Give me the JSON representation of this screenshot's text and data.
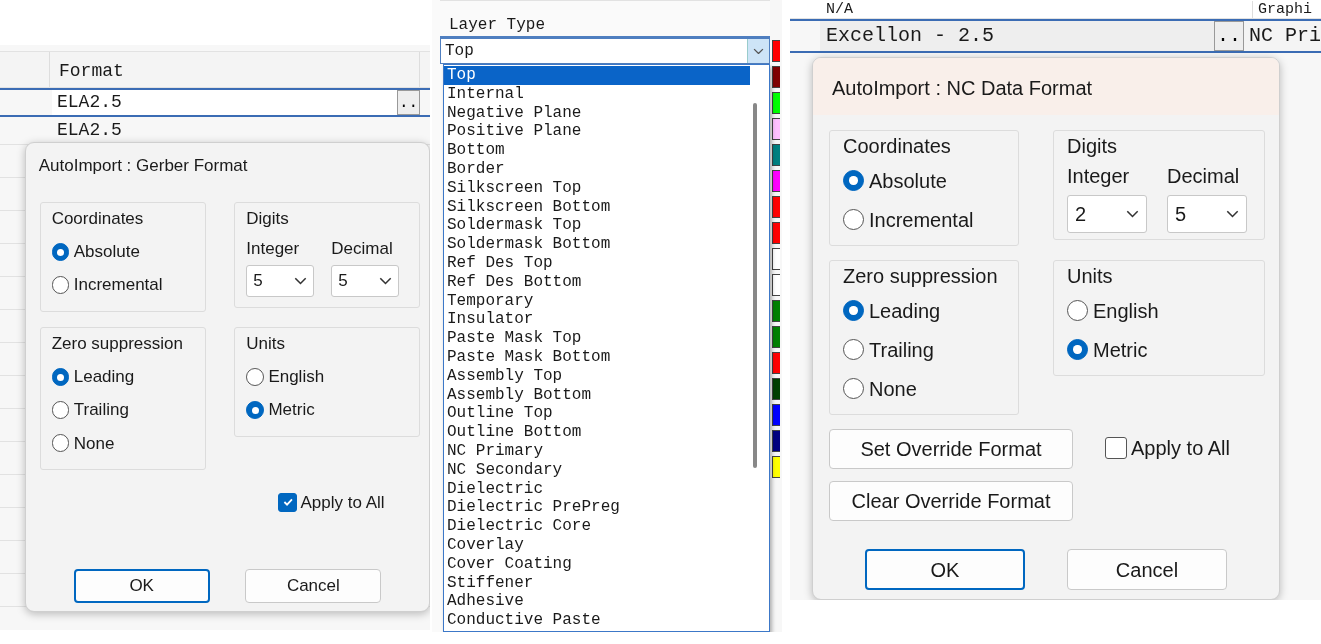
{
  "gerber_panel": {
    "table": {
      "header": "Format",
      "rows": [
        {
          "value": "ELA2.5",
          "selected": true,
          "button": ".."
        },
        {
          "value": "ELA2.5",
          "selected": false
        }
      ]
    },
    "dialog": {
      "kind": "gerber",
      "title": "AutoImport : Gerber Format",
      "groups": [
        {
          "kind": "radio",
          "title": "Coordinates",
          "options": [
            {
              "label": "Absolute",
              "selected": true
            },
            {
              "label": "Incremental",
              "selected": false
            }
          ]
        },
        {
          "kind": "dropdowns",
          "title": "Digits",
          "fields": [
            {
              "label": "Integer",
              "value": "5"
            },
            {
              "label": "Decimal",
              "value": "5"
            }
          ]
        },
        {
          "kind": "radio",
          "title": "Zero suppression",
          "options": [
            {
              "label": "Leading",
              "selected": true
            },
            {
              "label": "Trailing",
              "selected": false
            },
            {
              "label": "None",
              "selected": false
            }
          ]
        },
        {
          "kind": "radio",
          "title": "Units",
          "options": [
            {
              "label": "English",
              "selected": false
            },
            {
              "label": "Metric",
              "selected": true
            }
          ]
        }
      ],
      "apply_to_all": {
        "label": "Apply to All",
        "checked": true
      },
      "buttons": [
        {
          "label": "OK",
          "default": true
        },
        {
          "label": "Cancel",
          "default": false
        }
      ]
    }
  },
  "layer_type_panel": {
    "header": "Layer Type",
    "combo_value": "Top",
    "items": [
      {
        "label": "Top",
        "selected": true
      },
      {
        "label": "Internal",
        "selected": false
      },
      {
        "label": "Negative Plane",
        "selected": false
      },
      {
        "label": "Positive Plane",
        "selected": false
      },
      {
        "label": "Bottom",
        "selected": false
      },
      {
        "label": "Border",
        "selected": false
      },
      {
        "label": "Silkscreen Top",
        "selected": false
      },
      {
        "label": "Silkscreen Bottom",
        "selected": false
      },
      {
        "label": "Soldermask Top",
        "selected": false
      },
      {
        "label": "Soldermask Bottom",
        "selected": false
      },
      {
        "label": "Ref Des Top",
        "selected": false
      },
      {
        "label": "Ref Des Bottom",
        "selected": false
      },
      {
        "label": "Temporary",
        "selected": false
      },
      {
        "label": "Insulator",
        "selected": false
      },
      {
        "label": "Paste Mask Top",
        "selected": false
      },
      {
        "label": "Paste Mask Bottom",
        "selected": false
      },
      {
        "label": "Assembly Top",
        "selected": false
      },
      {
        "label": "Assembly Bottom",
        "selected": false
      },
      {
        "label": "Outline Top",
        "selected": false
      },
      {
        "label": "Outline Bottom",
        "selected": false
      },
      {
        "label": "NC Primary",
        "selected": false
      },
      {
        "label": "NC Secondary",
        "selected": false
      },
      {
        "label": "Dielectric",
        "selected": false
      },
      {
        "label": "Dielectric PrePreg",
        "selected": false
      },
      {
        "label": "Dielectric Core",
        "selected": false
      },
      {
        "label": "Coverlay",
        "selected": false
      },
      {
        "label": "Cover Coating",
        "selected": false
      },
      {
        "label": "Stiffener",
        "selected": false
      },
      {
        "label": "Adhesive",
        "selected": false
      },
      {
        "label": "Conductive Paste",
        "selected": false
      }
    ],
    "layer_colors": [
      {
        "color": "#ff0000"
      },
      {
        "color": "#800000"
      },
      {
        "color": "#00ff00"
      },
      {
        "color": "#ffc0ff"
      },
      {
        "color": "#008080"
      },
      {
        "color": "#ff00ff"
      },
      {
        "color": "#ff0000"
      },
      {
        "color": "#ff0000"
      },
      {
        "color": "#ffffff"
      },
      {
        "color": "#ffffff"
      },
      {
        "color": "#008000"
      },
      {
        "color": "#008000"
      },
      {
        "color": "#ff0000"
      },
      {
        "color": "#004000"
      },
      {
        "color": "#0000ff"
      },
      {
        "color": "#000080"
      },
      {
        "color": "#ffff00"
      }
    ]
  },
  "nc_panel": {
    "top_row": [
      "N/A",
      "Graphi"
    ],
    "row": {
      "value": "Excellon - 2.5",
      "selected": true,
      "button": "..",
      "next_cell": "NC Pri"
    },
    "dialog": {
      "kind": "nc",
      "title": "AutoImport : NC Data Format",
      "groups": [
        {
          "kind": "radio",
          "title": "Coordinates",
          "options": [
            {
              "label": "Absolute",
              "selected": true
            },
            {
              "label": "Incremental",
              "selected": false
            }
          ]
        },
        {
          "kind": "dropdowns",
          "title": "Digits",
          "fields": [
            {
              "label": "Integer",
              "value": "2"
            },
            {
              "label": "Decimal",
              "value": "5"
            }
          ]
        },
        {
          "kind": "radio",
          "title": "Zero suppression",
          "options": [
            {
              "label": "Leading",
              "selected": true
            },
            {
              "label": "Trailing",
              "selected": false
            },
            {
              "label": "None",
              "selected": false
            }
          ]
        },
        {
          "kind": "radio",
          "title": "Units",
          "options": [
            {
              "label": "English",
              "selected": false
            },
            {
              "label": "Metric",
              "selected": true
            }
          ]
        }
      ],
      "override_buttons": [
        "Set Override Format",
        "Clear Override Format"
      ],
      "apply_to_all": {
        "label": "Apply to All",
        "checked": false
      },
      "buttons": [
        {
          "label": "OK",
          "default": true
        },
        {
          "label": "Cancel",
          "default": false
        }
      ]
    }
  }
}
